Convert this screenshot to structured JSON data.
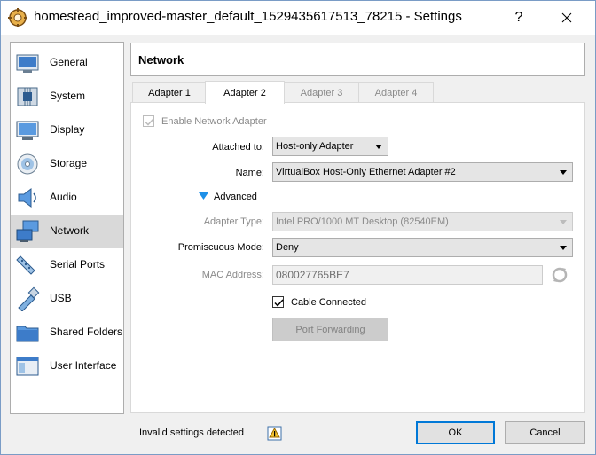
{
  "window": {
    "title": "homestead_improved-master_default_1529435617513_78215 - Settings",
    "help_glyph": "?",
    "close_glyph": "✕"
  },
  "sidebar": {
    "items": [
      {
        "label": "General",
        "icon": "general-icon"
      },
      {
        "label": "System",
        "icon": "system-icon"
      },
      {
        "label": "Display",
        "icon": "display-icon"
      },
      {
        "label": "Storage",
        "icon": "storage-icon"
      },
      {
        "label": "Audio",
        "icon": "audio-icon"
      },
      {
        "label": "Network",
        "icon": "network-icon",
        "selected": true
      },
      {
        "label": "Serial Ports",
        "icon": "serial-ports-icon"
      },
      {
        "label": "USB",
        "icon": "usb-icon"
      },
      {
        "label": "Shared Folders",
        "icon": "shared-folders-icon"
      },
      {
        "label": "User Interface",
        "icon": "user-interface-icon"
      }
    ]
  },
  "page": {
    "title": "Network"
  },
  "tabs": [
    {
      "label": "Adapter 1",
      "state": "enabled"
    },
    {
      "label": "Adapter 2",
      "state": "active"
    },
    {
      "label": "Adapter 3",
      "state": "disabled"
    },
    {
      "label": "Adapter 4",
      "state": "disabled"
    }
  ],
  "adapter": {
    "enable_label": "Enable Network Adapter",
    "enable_checked": true,
    "attached_label": "Attached to:",
    "attached_value": "Host-only Adapter",
    "name_label": "Name:",
    "name_value": "VirtualBox Host-Only Ethernet Adapter #2",
    "advanced_label": "Advanced",
    "adapter_type_label": "Adapter Type:",
    "adapter_type_value": "Intel PRO/1000 MT Desktop (82540EM)",
    "promiscuous_label": "Promiscuous Mode:",
    "promiscuous_value": "Deny",
    "mac_label": "MAC Address:",
    "mac_value": "080027765BE7",
    "cable_label": "Cable Connected",
    "cable_checked": true,
    "port_forwarding_label": "Port Forwarding"
  },
  "footer": {
    "status_text": "Invalid settings detected",
    "ok_label": "OK",
    "cancel_label": "Cancel"
  },
  "colors": {
    "selection": "#d9d9d9",
    "accent": "#0078d7",
    "disabled_text": "#8a8a8a"
  }
}
